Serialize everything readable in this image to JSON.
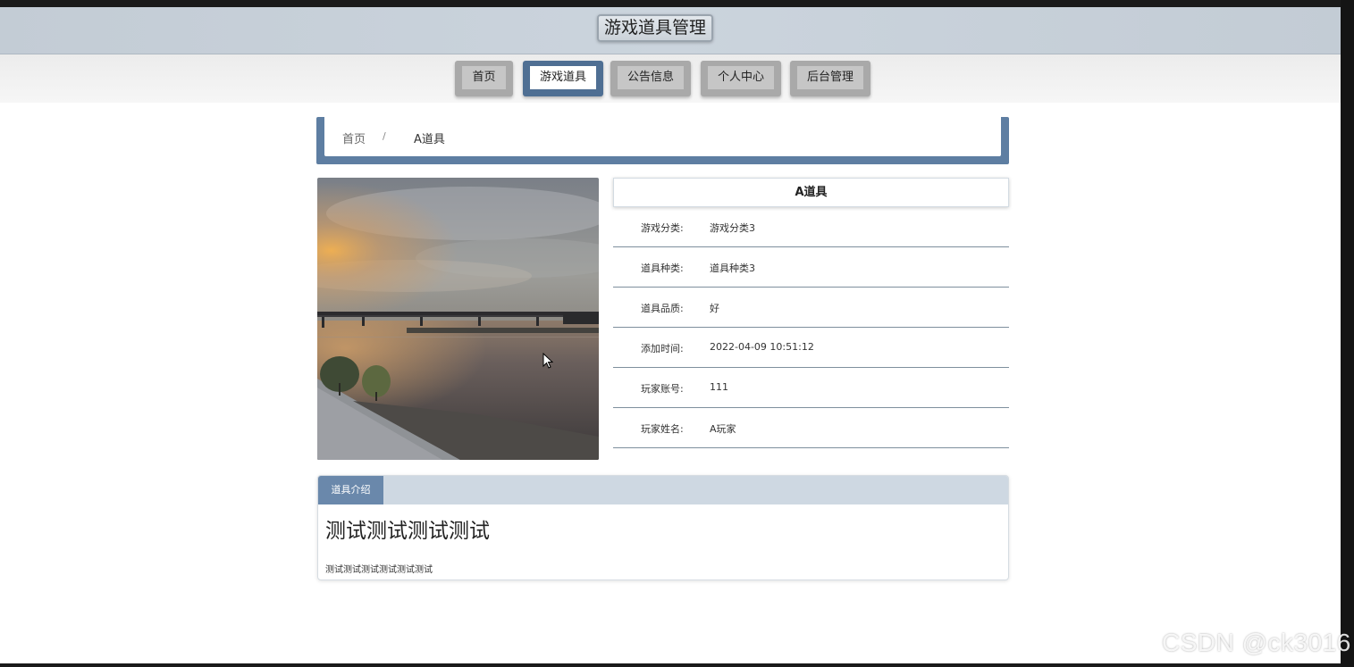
{
  "header": {
    "title": "游戏道具管理"
  },
  "nav": {
    "items": [
      {
        "label": "首页",
        "active": false
      },
      {
        "label": "游戏道具",
        "active": true
      },
      {
        "label": "公告信息",
        "active": false
      },
      {
        "label": "个人中心",
        "active": false
      },
      {
        "label": "后台管理",
        "active": false
      }
    ]
  },
  "breadcrumb": {
    "home": "首页",
    "separator": "/",
    "current": "A道具"
  },
  "detail": {
    "title": "A道具",
    "rows": [
      {
        "label": "游戏分类:",
        "value": "游戏分类3"
      },
      {
        "label": "道具种类:",
        "value": "道具种类3"
      },
      {
        "label": "道具品质:",
        "value": "好"
      },
      {
        "label": "添加时间:",
        "value": "2022-04-09 10:51:12"
      },
      {
        "label": "玩家账号:",
        "value": "111"
      },
      {
        "label": "玩家姓名:",
        "value": "A玩家"
      }
    ]
  },
  "intro": {
    "tab": "道具介绍",
    "heading": "测试测试测试测试",
    "body": "测试测试测试测试测试测试"
  },
  "watermark": "CSDN @ck3016",
  "colors": {
    "accent": "#5e7ea2",
    "nav_inactive": "#a9a9a9",
    "header_bg": "#c8d1da"
  }
}
